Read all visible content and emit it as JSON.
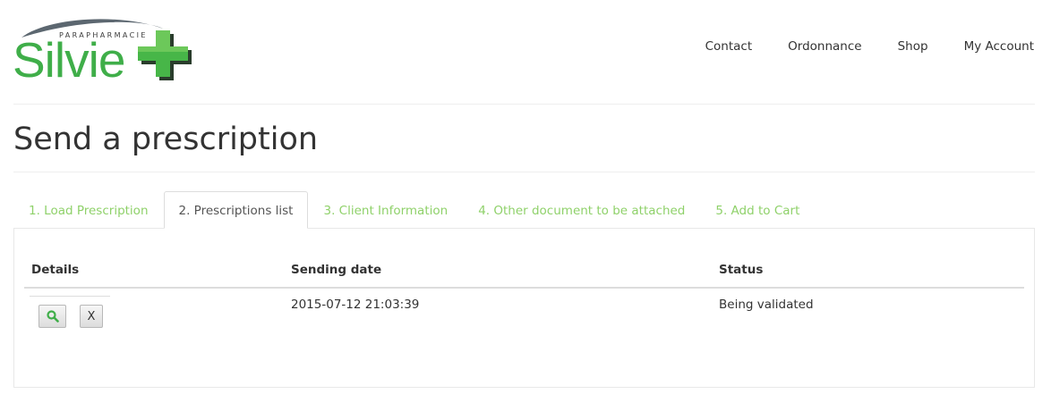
{
  "brand": {
    "subtitle": "PARAPHARMACIE",
    "name": "Silvie",
    "primary_color": "#3fae49",
    "dark_color": "#2a3d2c"
  },
  "nav": {
    "items": [
      {
        "label": "Contact"
      },
      {
        "label": "Ordonnance"
      },
      {
        "label": "Shop"
      },
      {
        "label": "My Account"
      }
    ]
  },
  "page": {
    "title": "Send a prescription"
  },
  "tabs": {
    "items": [
      {
        "label": "1. Load Prescription",
        "active": false
      },
      {
        "label": "2. Prescriptions list",
        "active": true
      },
      {
        "label": "3. Client Information",
        "active": false
      },
      {
        "label": "4. Other document to be attached",
        "active": false
      },
      {
        "label": "5. Add to Cart",
        "active": false
      }
    ],
    "link_color": "#8fd16a"
  },
  "table": {
    "headers": {
      "details": "Details",
      "sending_date": "Sending date",
      "status": "Status"
    },
    "rows": [
      {
        "view_icon": "magnifier-icon",
        "delete_label": "X",
        "sending_date": "2015-07-12 21:03:39",
        "status": "Being validated"
      }
    ]
  }
}
